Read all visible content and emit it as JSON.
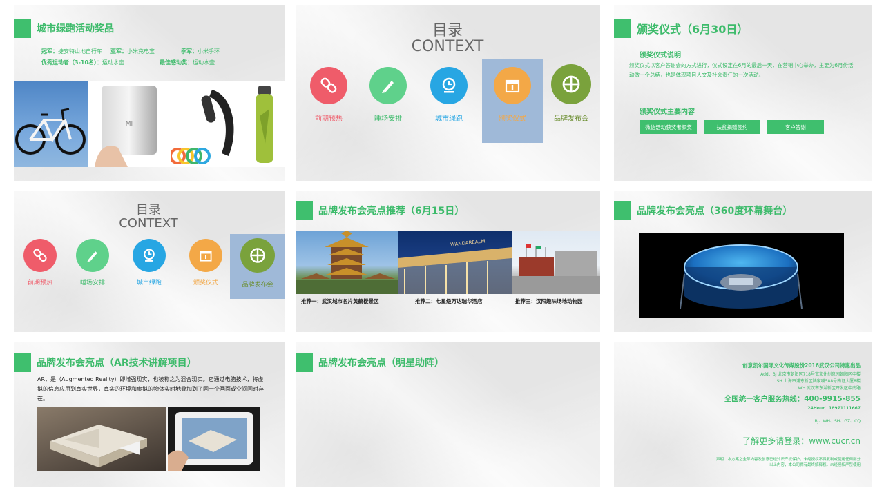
{
  "slide1": {
    "title": "城市绿跑活动奖品",
    "prizes": [
      {
        "label": "冠军：",
        "value": "捷安特山地自行车"
      },
      {
        "label": "亚军：",
        "value": "小米充电宝"
      },
      {
        "label": "季军：",
        "value": "小米手环"
      },
      {
        "label": "优秀运动者（3-10名）：",
        "value": "运动水壶"
      },
      {
        "label": "最佳感动奖：",
        "value": "运动水壶"
      }
    ]
  },
  "toc": {
    "title_cn": "目录",
    "title_en": "CONTEXT",
    "items": [
      "前期预热",
      "睡场安排",
      "城市绿跑",
      "颁奖仪式",
      "品牌发布会"
    ]
  },
  "colors": {
    "accent_green": "#3fbf6e",
    "red": "#ef5c6a",
    "green": "#5fd18b",
    "blue": "#27a6e3",
    "orange": "#f3a847",
    "olive": "#7aa23c",
    "active_highlight": "#9fb9d8"
  },
  "slide3": {
    "title": "颁奖仪式（6月30日）",
    "desc_heading": "颁奖仪式说明",
    "desc_text": "颁奖仪式以客户答谢会的方式进行，仪式设定在6月的最后一天，在营销中心举办，主要为6月份活动做一个总结，也是体现项目人文及社会责任的一次活动。",
    "content_heading": "颁奖仪式主要内容",
    "buttons": [
      "微信活动获奖者颁奖",
      "扶贫捐赠签约",
      "客户答谢"
    ]
  },
  "slide5": {
    "title": "品牌发布会亮点推荐（6月15日）",
    "captions": [
      "推荐一：武汉城市名片黄鹤楼景区",
      "推荐二：七星级万达瑞华酒店",
      "推荐三：汉阳趣味场地动物园"
    ],
    "hotel_sign": "WANDAREALM"
  },
  "slide6": {
    "title": "品牌发布会亮点（360度环幕舞台）"
  },
  "slide7": {
    "title": "品牌发布会亮点（AR技术讲解项目）",
    "text": "AR，是（Augmented Reality）即增强现实，也被称之为混合现实。它通过电脑技术，将虚拟的信息应用到真实世界，真实的环境和虚拟的物体实时地叠加到了同一个画面或空间同时存在。"
  },
  "slide8": {
    "title": "品牌发布会亮点（明星助阵）"
  },
  "slide9": {
    "company": "创意凯尔国际文化传媒股份2016武汉公司特惠出品",
    "addresses": [
      "Add：BJ 北京市朝阳区718号宽文化创意园朝阳区中楼",
      "SH 上海市浦东新区陆家嘴588号南证大厦8楼",
      "WH 武汉市东湖新区开发区中南路"
    ],
    "hotline": "全国统一客户服务热线：400-9915-855",
    "hour24": "24Hour：18971111667",
    "cities": "BJ、WH、SH、GZ、CQ",
    "more": "了解更多请登录：www.cucr.cn",
    "disclaimer1": "声明：本方案之全部内容及创意已经知识产权保护，未经授权不得复制或使用任何部分",
    "disclaimer2": "以上内容，本公司拥有最终解释权。未经授权严禁使用"
  }
}
